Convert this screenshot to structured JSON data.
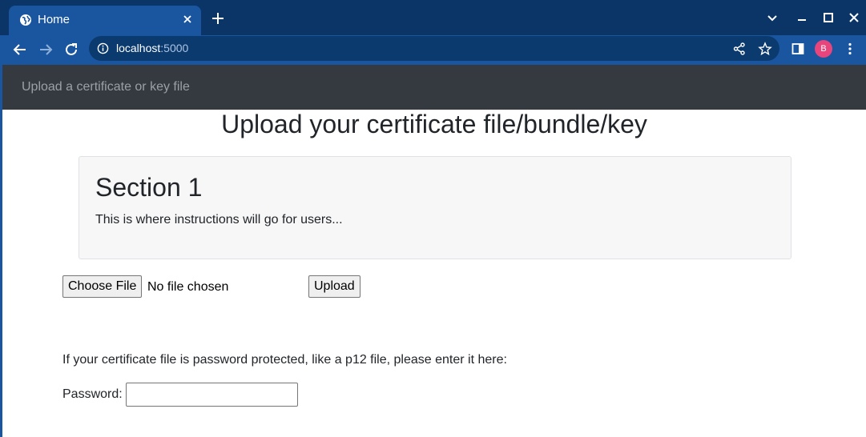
{
  "browser": {
    "tab_title": "Home",
    "url_host": "localhost",
    "url_port": ":5000",
    "profile_initial": "B",
    "icons": [
      "globe-icon",
      "close-icon",
      "plus-icon",
      "chevron-down-icon",
      "minimize-icon",
      "maximize-icon",
      "window-close-icon",
      "back-arrow-icon",
      "forward-arrow-icon",
      "reload-icon",
      "info-icon",
      "share-icon",
      "star-icon",
      "side-panel-icon",
      "kebab-menu-icon"
    ]
  },
  "navbar": {
    "brand": "Upload a certificate or key file"
  },
  "main": {
    "title": "Upload your certificate file/bundle/key",
    "section": {
      "heading": "Section 1",
      "text": "This is where instructions will go for users..."
    },
    "upload": {
      "choose_file_label": "Choose File",
      "no_file_text": "No file chosen",
      "upload_label": "Upload"
    },
    "password": {
      "note": "If your certificate file is password protected, like a p12 file, please enter it here:",
      "label": "Password:",
      "value": ""
    }
  },
  "colors": {
    "tab_strip": "#0a3566",
    "toolbar": "#1a56a0",
    "navbar": "#343a40",
    "avatar": "#e8457c"
  }
}
